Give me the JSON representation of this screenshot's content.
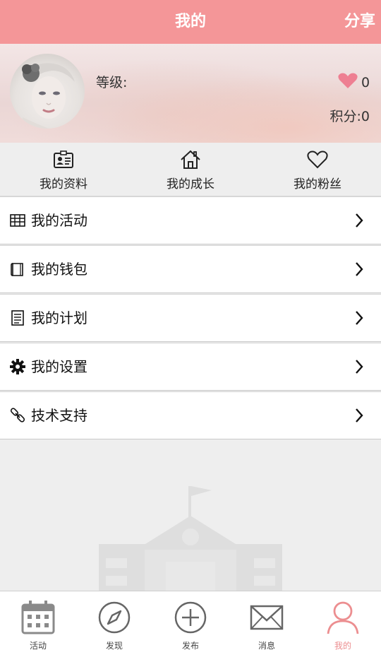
{
  "header": {
    "title": "我的",
    "share_label": "分享"
  },
  "profile": {
    "level_label": "等级:",
    "likes": "0",
    "points": "积分:0"
  },
  "quick_links": [
    {
      "label": "我的资料",
      "icon": "id-card-icon"
    },
    {
      "label": "我的成长",
      "icon": "home-icon"
    },
    {
      "label": "我的粉丝",
      "icon": "heart-outline-icon"
    }
  ],
  "menu": [
    {
      "label": "我的活动",
      "icon": "table-icon"
    },
    {
      "label": "我的钱包",
      "icon": "wallet-icon"
    },
    {
      "label": "我的计划",
      "icon": "document-icon"
    },
    {
      "label": "我的设置",
      "icon": "gear-icon"
    },
    {
      "label": "技术支持",
      "icon": "link-icon"
    }
  ],
  "tabs": [
    {
      "label": "活动",
      "icon": "calendar-icon"
    },
    {
      "label": "发现",
      "icon": "compass-icon"
    },
    {
      "label": "发布",
      "icon": "plus-circle-icon"
    },
    {
      "label": "消息",
      "icon": "mail-icon"
    },
    {
      "label": "我的",
      "icon": "user-icon",
      "active": true
    }
  ],
  "colors": {
    "accent": "#f49698",
    "active_tab": "#ec8e90",
    "heart": "#ee7f92"
  }
}
